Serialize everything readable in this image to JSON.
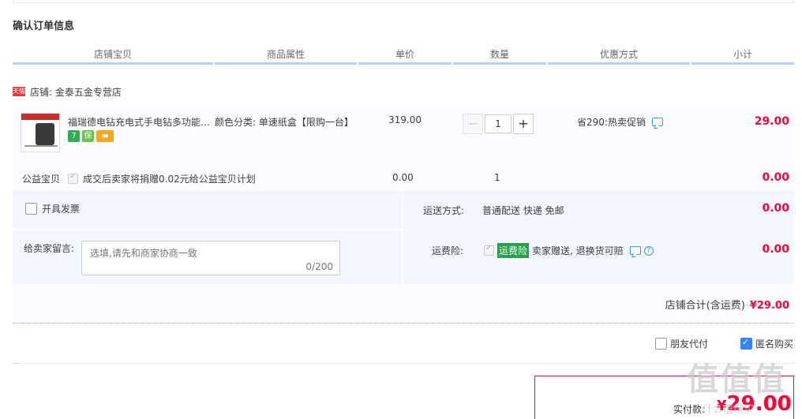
{
  "section_title": "确认订单信息",
  "columns": [
    "店铺宝贝",
    "商品属性",
    "单价",
    "数量",
    "优惠方式",
    "小计"
  ],
  "shop": {
    "badge": "天猫",
    "label": "店铺: 金泰五金专营店"
  },
  "item": {
    "title": "福瑞德电钻充电式手电钻多功能家用电动螺丝刀",
    "attr": "颜色分类: 单速纸盒【限购一台】",
    "price": "319.00",
    "qty": "1",
    "minus": "−",
    "plus": "+",
    "promo": "省290:热卖促销",
    "subtotal": "29.00",
    "icon_seven": "7",
    "icon_bao": "保",
    "icon_card": "▬"
  },
  "charity": {
    "label": "公益宝贝",
    "text": "成交后卖家将捐赠0.02元给公益宝贝计划",
    "price": "0.00",
    "qty": "1",
    "subtotal": "0.00"
  },
  "invoice_label": "开具发票",
  "message": {
    "label": "给卖家留言:",
    "placeholder": "选填,请先和商家协商一致",
    "counter": "0/200"
  },
  "shipping": {
    "label": "运送方式:",
    "value": "普通配送 快递 免邮",
    "price": "0.00"
  },
  "insurance": {
    "label": "运费险:",
    "tag": "运费险",
    "text": "卖家赠送, 退换货可赔",
    "price": "0.00",
    "help": "?"
  },
  "shop_total": {
    "label": "店铺合计(含运费)",
    "amount": "¥29.00"
  },
  "options": {
    "friend_pay": "朋友代付",
    "anonymous": "匿名购买"
  },
  "pay": {
    "label": "实付款:",
    "currency": "¥",
    "amount": "29.00"
  },
  "watermark": {
    "main": "值值值",
    "sub": "什么值得买"
  },
  "colors": {
    "accent_red": "#ff0036",
    "header_border": "#b2d1ff",
    "panel_bg": "#f2f7ff",
    "checkbox_blue": "#3385ff",
    "insurance_green": "#27a04a"
  }
}
